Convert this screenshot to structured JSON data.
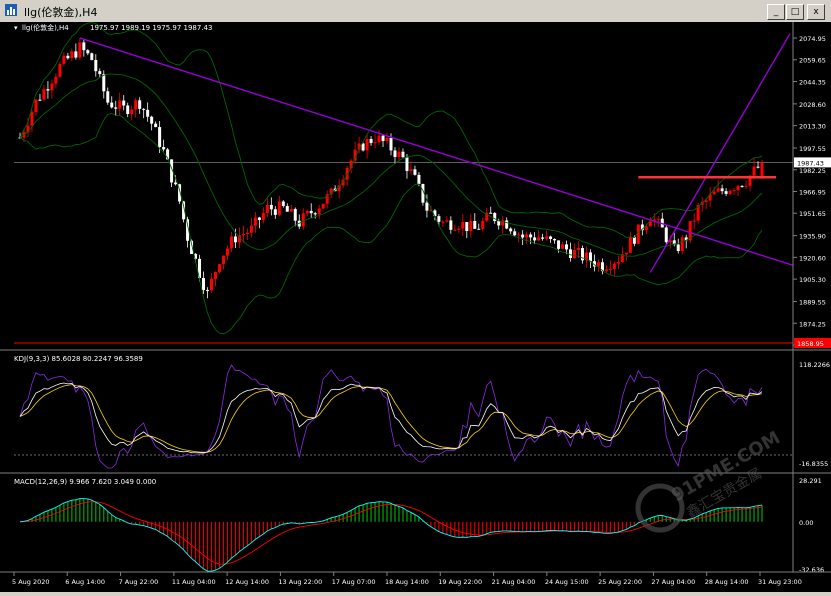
{
  "window": {
    "title": "llg(伦敦金),H4",
    "minimize_label": "_",
    "restore_label": "□",
    "close_label": "x"
  },
  "main_panel": {
    "title": "llg(伦敦金),H4",
    "ohlc": "1975.97 1989.19 1975.97 1987.43",
    "price_labels": [
      "2074.95",
      "2059.65",
      "2044.35",
      "2028.60",
      "2013.30",
      "1997.55",
      "1982.25",
      "1966.95",
      "1951.65",
      "1935.90",
      "1920.60",
      "1905.30",
      "1889.55",
      "1874.25",
      "1858.95"
    ],
    "current_price": "1987.43",
    "low_line_label": "1858.95"
  },
  "kdj_panel": {
    "title": "KDJ(9,3,3) 85.6028 80.2247 96.3589",
    "top_label": "118.2266",
    "bottom_label": "-16.8355"
  },
  "macd_panel": {
    "title": "MACD(12,26,9) 9.966 7.620 3.049 0.000",
    "top_label": "28.291",
    "zero_label": "0.00",
    "bottom_label": "-32.636"
  },
  "time_axis": [
    "5 Aug 2020",
    "6 Aug 14:00",
    "7 Aug 22:00",
    "11 Aug 04:00",
    "12 Aug 14:00",
    "13 Aug 22:00",
    "17 Aug 07:00",
    "18 Aug 14:00",
    "19 Aug 22:00",
    "21 Aug 04:00",
    "24 Aug 15:00",
    "25 Aug 22:00",
    "27 Aug 04:00",
    "28 Aug 14:00",
    "31 Aug 23:00"
  ],
  "watermark": {
    "brand": "91PME.COM",
    "tagline": "鑫汇宝贵金属"
  },
  "colors": {
    "background": "#000000",
    "bull_candle": "#ff0000",
    "bear_candle": "#ffffff",
    "trendline": "#9400d3",
    "support_line": "#ff3333",
    "bollinger": "#006400",
    "kdj_k": "#ffffff",
    "kdj_d": "#ffd700",
    "kdj_j": "#8a2be2",
    "macd_hist_pos": "#00aa00",
    "macd_hist_neg": "#dd0000",
    "macd_line": "#00ffff",
    "signal_line": "#ff0000"
  }
}
